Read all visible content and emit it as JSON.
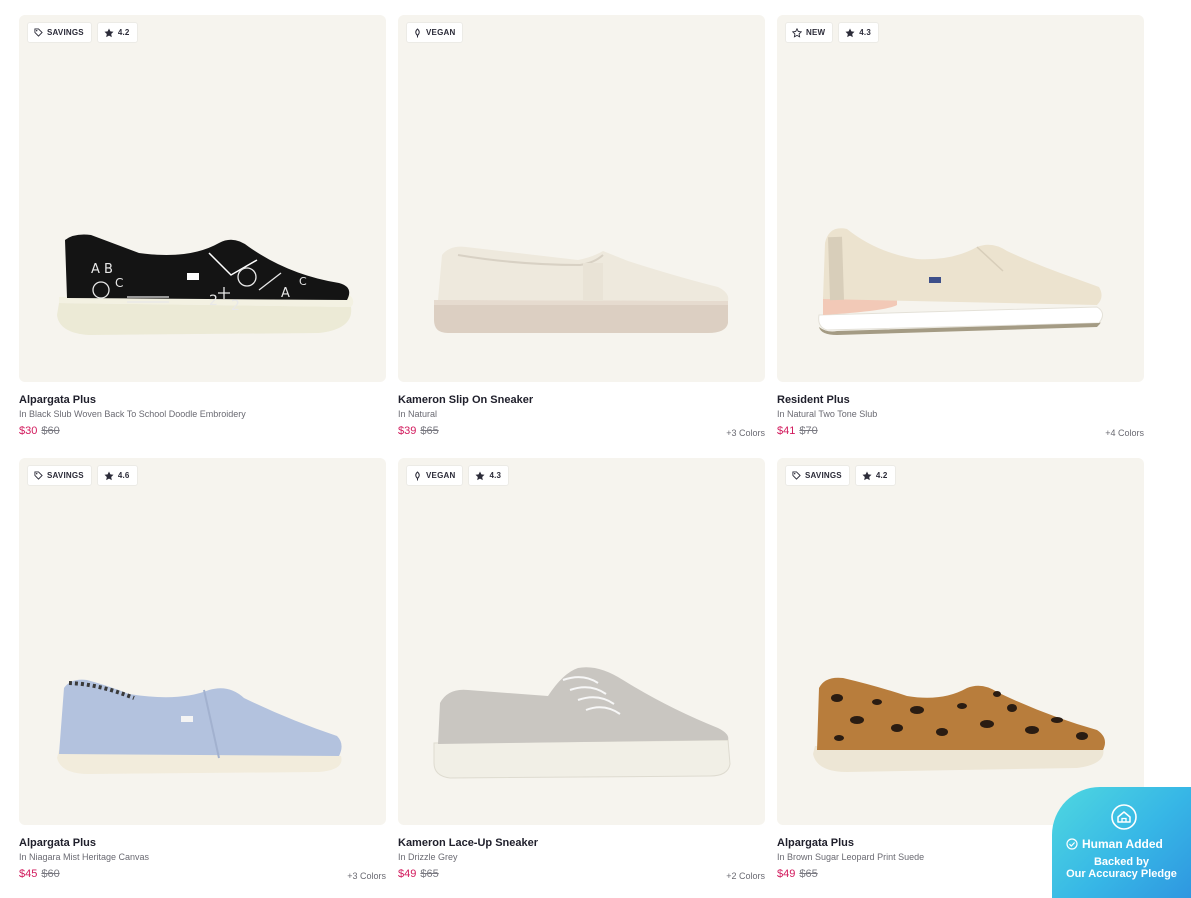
{
  "products": [
    {
      "badges": [
        {
          "icon": "tag-icon",
          "label": "SAVINGS"
        },
        {
          "icon": "star-icon",
          "label": "4.2"
        }
      ],
      "name": "Alpargata Plus",
      "variant": "In Black Slub Woven Back To School Doodle Embroidery",
      "sale_price": "$30",
      "original_price": "$60",
      "colors": ""
    },
    {
      "badges": [
        {
          "icon": "leaf-icon",
          "label": "VEGAN"
        }
      ],
      "name": "Kameron Slip On Sneaker",
      "variant": "In Natural",
      "sale_price": "$39",
      "original_price": "$65",
      "colors": "+3 Colors"
    },
    {
      "badges": [
        {
          "icon": "star-outline-icon",
          "label": "NEW"
        },
        {
          "icon": "star-icon",
          "label": "4.3"
        }
      ],
      "name": "Resident Plus",
      "variant": "In Natural Two Tone Slub",
      "sale_price": "$41",
      "original_price": "$70",
      "colors": "+4 Colors"
    },
    {
      "badges": [
        {
          "icon": "tag-icon",
          "label": "SAVINGS"
        },
        {
          "icon": "star-icon",
          "label": "4.6"
        }
      ],
      "name": "Alpargata Plus",
      "variant": "In Niagara Mist Heritage Canvas",
      "sale_price": "$45",
      "original_price": "$60",
      "colors": "+3 Colors"
    },
    {
      "badges": [
        {
          "icon": "leaf-icon",
          "label": "VEGAN"
        },
        {
          "icon": "star-icon",
          "label": "4.3"
        }
      ],
      "name": "Kameron Lace-Up Sneaker",
      "variant": "In Drizzle Grey",
      "sale_price": "$49",
      "original_price": "$65",
      "colors": "+2 Colors"
    },
    {
      "badges": [
        {
          "icon": "tag-icon",
          "label": "SAVINGS"
        },
        {
          "icon": "star-icon",
          "label": "4.2"
        }
      ],
      "name": "Alpargata Plus",
      "variant": "In Brown Sugar Leopard Print Suede",
      "sale_price": "$49",
      "original_price": "$65",
      "colors": ""
    }
  ],
  "pledge": {
    "icon": "home-check-icon",
    "title": "Human Added",
    "line1": "Backed by",
    "line2": "Our Accuracy Pledge"
  },
  "colors": {
    "card_bg": "#f6f4ee",
    "sale_price": "#d2195c",
    "pledge_gradient_start": "#4fd8e0",
    "pledge_gradient_end": "#2f97e0"
  }
}
